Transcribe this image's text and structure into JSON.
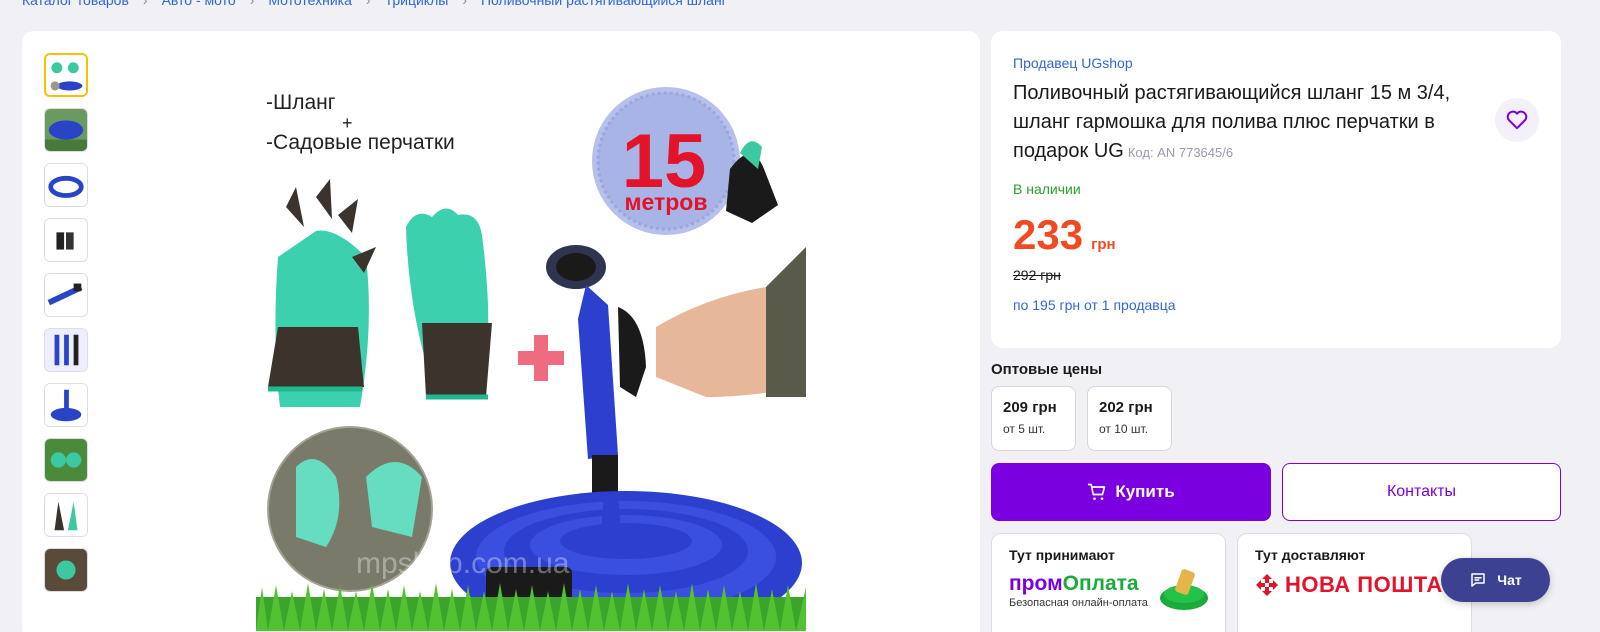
{
  "breadcrumb": [
    "Каталог товаров",
    "Авто - мото",
    "Мототехника",
    "Трициклы",
    "Поливочный растягивающийся шланг"
  ],
  "gallery": {
    "thumbnail_count": 10,
    "image_text": {
      "line1": "-Шланг",
      "plus": "+",
      "line2": "-Садовые перчатки",
      "badge_number": "15",
      "badge_word": "метров",
      "watermark": "mpshop.com.ua"
    }
  },
  "product": {
    "seller": "Продавец UGshop",
    "title": "Поливочный растягивающийся шланг 15 м 3/4, шланг гармошка для полива плюс перчатки в подарок UG",
    "code": "Код: AN 773645/6",
    "availability": "В наличии",
    "price_value": "233",
    "price_currency": "грн",
    "old_price": "292 грн",
    "promo_price": "по 195 грн от 1 продавца"
  },
  "wholesale": {
    "title": "Оптовые цены",
    "tiers": [
      {
        "price": "209 грн",
        "qty": "от 5 шт."
      },
      {
        "price": "202 грн",
        "qty": "от 10 шт."
      }
    ]
  },
  "actions": {
    "buy_label": "Купить",
    "contacts_label": "Контакты"
  },
  "payment": {
    "heading": "Тут принимают",
    "logo_part1": "пром",
    "logo_part2": "Оплата",
    "subtitle": "Безопасная онлайн-оплата"
  },
  "delivery": {
    "heading": "Тут доставляют",
    "logo": "НОВА ПОШТА"
  },
  "chat": {
    "label": "Чат"
  },
  "colors": {
    "accent": "#7b00e0",
    "price": "#f04a23",
    "link": "#3367d6",
    "in_stock": "#2ba02b",
    "chat_bg": "#3d4192"
  }
}
